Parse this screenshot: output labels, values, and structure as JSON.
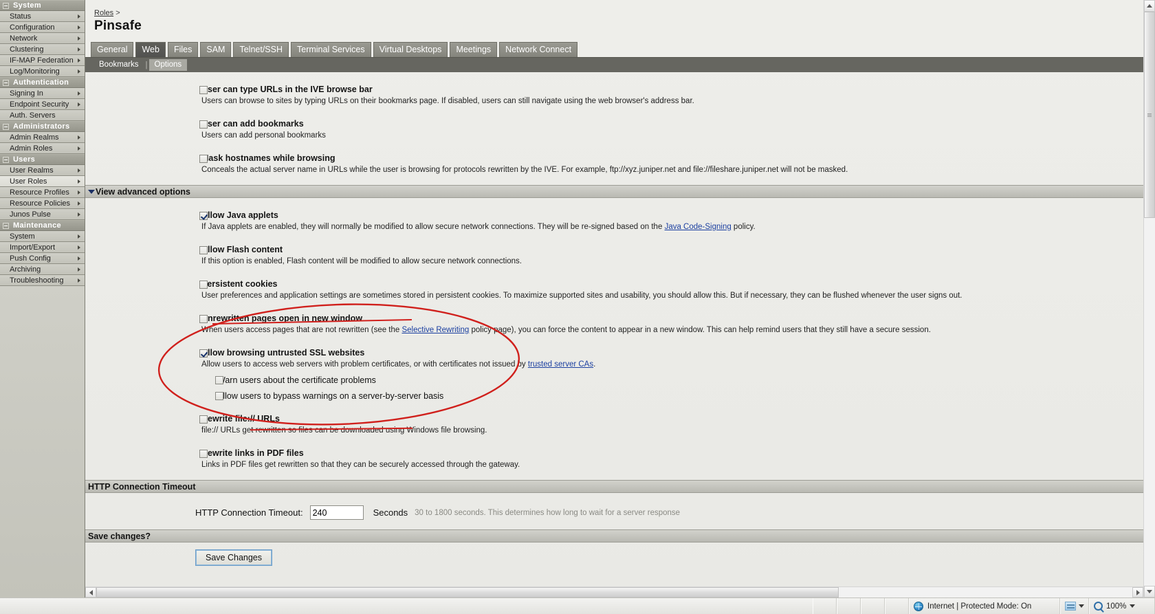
{
  "sidebar": {
    "groups": [
      {
        "label": "System",
        "items": [
          {
            "label": "Status",
            "arrow": true,
            "selected": false
          },
          {
            "label": "Configuration",
            "arrow": true,
            "selected": false
          },
          {
            "label": "Network",
            "arrow": true,
            "selected": false
          },
          {
            "label": "Clustering",
            "arrow": true,
            "selected": false
          },
          {
            "label": "IF-MAP Federation",
            "arrow": true,
            "selected": false
          },
          {
            "label": "Log/Monitoring",
            "arrow": true,
            "selected": false
          }
        ]
      },
      {
        "label": "Authentication",
        "items": [
          {
            "label": "Signing In",
            "arrow": true,
            "selected": false
          },
          {
            "label": "Endpoint Security",
            "arrow": true,
            "selected": false
          },
          {
            "label": "Auth. Servers",
            "arrow": false,
            "selected": false
          }
        ]
      },
      {
        "label": "Administrators",
        "items": [
          {
            "label": "Admin Realms",
            "arrow": true,
            "selected": false
          },
          {
            "label": "Admin Roles",
            "arrow": true,
            "selected": false
          }
        ]
      },
      {
        "label": "Users",
        "items": [
          {
            "label": "User Realms",
            "arrow": true,
            "selected": false
          },
          {
            "label": "User Roles",
            "arrow": true,
            "selected": true
          },
          {
            "label": "Resource Profiles",
            "arrow": true,
            "selected": false
          },
          {
            "label": "Resource Policies",
            "arrow": true,
            "selected": false
          },
          {
            "label": "Junos Pulse",
            "arrow": true,
            "selected": false
          }
        ]
      },
      {
        "label": "Maintenance",
        "items": [
          {
            "label": "System",
            "arrow": true,
            "selected": false
          },
          {
            "label": "Import/Export",
            "arrow": true,
            "selected": false
          },
          {
            "label": "Push Config",
            "arrow": true,
            "selected": false
          },
          {
            "label": "Archiving",
            "arrow": true,
            "selected": false
          },
          {
            "label": "Troubleshooting",
            "arrow": true,
            "selected": false
          }
        ]
      }
    ]
  },
  "header": {
    "breadcrumb_parent": "Roles",
    "breadcrumb_sep": ">",
    "title": "Pinsafe"
  },
  "tabs": [
    {
      "label": "General",
      "active": false
    },
    {
      "label": "Web",
      "active": true
    },
    {
      "label": "Files",
      "active": false
    },
    {
      "label": "SAM",
      "active": false
    },
    {
      "label": "Telnet/SSH",
      "active": false
    },
    {
      "label": "Terminal Services",
      "active": false
    },
    {
      "label": "Virtual Desktops",
      "active": false
    },
    {
      "label": "Meetings",
      "active": false
    },
    {
      "label": "Network Connect",
      "active": false
    }
  ],
  "subtabs": [
    {
      "label": "Bookmarks",
      "active": false
    },
    {
      "label": "Options",
      "active": true
    }
  ],
  "options_top": [
    {
      "title": "User can type URLs in the IVE browse bar",
      "desc": "Users can browse to sites by typing URLs on their bookmarks page. If disabled, users can still navigate using the web browser's address bar.",
      "checked": false
    },
    {
      "title": "User can add bookmarks",
      "desc": "Users can add personal bookmarks",
      "checked": false
    },
    {
      "title": "Mask hostnames while browsing",
      "desc": "Conceals the actual server name in URLs while the user is browsing for protocols rewritten by the IVE. For example, ftp://xyz.juniper.net and file://fileshare.juniper.net will not be masked.",
      "checked": false
    }
  ],
  "advanced_section": {
    "label": "View advanced options"
  },
  "options_advanced": [
    {
      "title": "Allow Java applets",
      "checked": true,
      "desc_pre": "If Java applets are enabled, they will normally be modified to allow secure network connections. They will be re-signed based on the ",
      "link": "Java Code-Signing",
      "desc_post": " policy."
    },
    {
      "title": "Allow Flash content",
      "checked": false,
      "desc_pre": "If this option is enabled, Flash content will be modified to allow secure network connections.",
      "link": "",
      "desc_post": ""
    },
    {
      "title": "Persistent cookies",
      "checked": false,
      "desc_pre": "User preferences and application settings are sometimes stored in persistent cookies. To maximize supported sites and usability, you should allow this. But if necessary, they can be flushed whenever the user signs out.",
      "link": "",
      "desc_post": ""
    },
    {
      "title": "Unrewritten pages open in new window",
      "checked": false,
      "desc_pre": "When users access pages that are not rewritten (see the ",
      "link": "Selective Rewriting",
      "desc_post": " policy page), you can force the content to appear in a new window. This can help remind users that they still have a secure session."
    },
    {
      "title": "Allow browsing untrusted SSL websites",
      "checked": true,
      "desc_pre": "Allow users to access web servers with problem certificates, or with certificates not issued by ",
      "link": "trusted server CAs",
      "desc_post": "."
    }
  ],
  "ssl_suboptions": [
    {
      "label": "Warn users about the certificate problems",
      "checked": false
    },
    {
      "label": "Allow users to bypass warnings on a server-by-server basis",
      "checked": false
    }
  ],
  "options_tail": [
    {
      "title": "Rewrite file:// URLs",
      "checked": false,
      "desc_pre": "file:// URLs get rewritten so files can be downloaded using Windows file browsing.",
      "link": "",
      "desc_post": ""
    },
    {
      "title": "Rewrite links in PDF files",
      "checked": false,
      "desc_pre": "Links in PDF files get rewritten so that they can be securely accessed through the gateway.",
      "link": "",
      "desc_post": ""
    }
  ],
  "http_timeout": {
    "section_label": "HTTP Connection Timeout",
    "field_label": "HTTP Connection Timeout:",
    "value": "240",
    "unit": "Seconds",
    "hint": "30 to 1800 seconds. This determines how long to wait for a server response"
  },
  "save": {
    "section_label": "Save changes?",
    "button_label": "Save Changes"
  },
  "statusbar": {
    "zone": "Internet | Protected Mode: On",
    "zoom": "100%"
  },
  "colors": {
    "annotation": "#d0201c",
    "link": "#1b3fa0",
    "sidebar": "#9c9c92",
    "tab_active": "#5f5f5a"
  }
}
